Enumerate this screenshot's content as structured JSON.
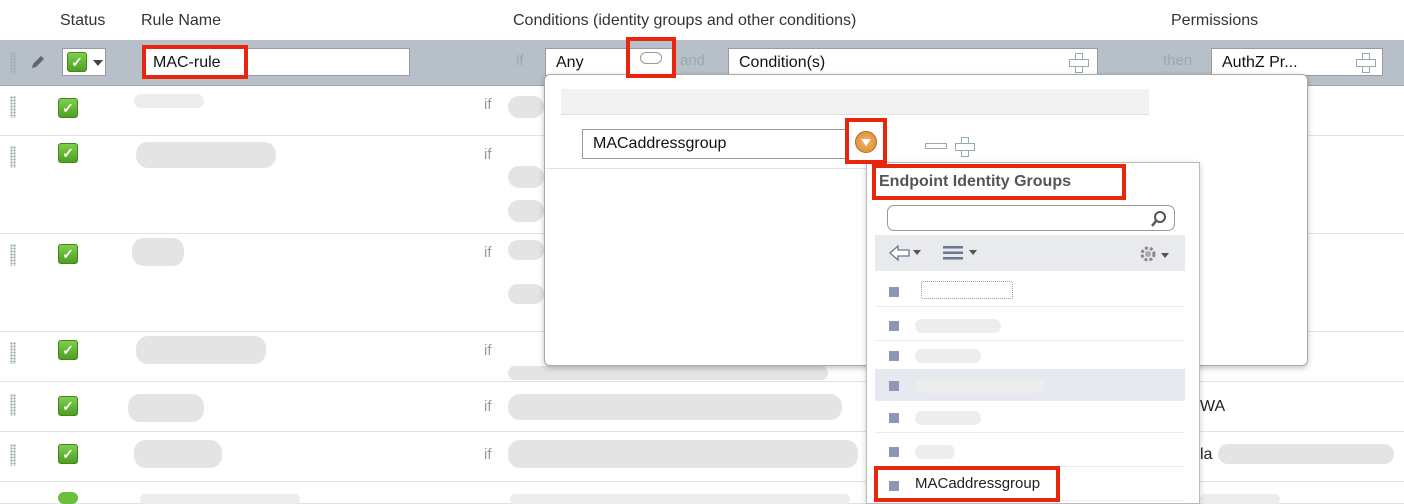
{
  "header": {
    "status": "Status",
    "rule_name": "Rule Name",
    "conditions": "Conditions (identity groups and other conditions)",
    "permissions": "Permissions"
  },
  "editing_row": {
    "rule_name_value": "MAC-rule",
    "if": "if",
    "identity_group_value": "Any",
    "and": "and",
    "condition_value": "Condition(s)",
    "then": "then",
    "permission_value": "AuthZ Pr...",
    "checkmark": "✓"
  },
  "rows": [
    {
      "if": "if",
      "checkmark": "✓"
    },
    {
      "if": "if",
      "checkmark": "✓"
    },
    {
      "if": "if",
      "checkmark": "✓"
    },
    {
      "if": "if",
      "checkmark": "✓"
    },
    {
      "if": "if",
      "checkmark": "✓"
    },
    {
      "if": "if",
      "checkmark": "✓"
    }
  ],
  "row_fragments": {
    "wa": "WA",
    "la": "la"
  },
  "condition_popup": {
    "group_select_value": "MACaddressgroup"
  },
  "identity_groups_panel": {
    "title": "Endpoint Identity Groups",
    "search_value": "",
    "selected_item": "MACaddressgroup"
  },
  "colors": {
    "highlight_red": "#e8260e",
    "selected_row_bg": "#b7c0c9",
    "checkbox_green": "#5aab2e",
    "dropdown_orange": "#d98a2b"
  },
  "icons": {
    "edit": "pencil-icon",
    "add": "plus-icon",
    "remove": "minus-icon",
    "search": "search-icon",
    "back": "back-arrow-icon",
    "list": "list-view-icon",
    "settings": "gear-icon",
    "dropdown": "chevron-down-icon"
  }
}
